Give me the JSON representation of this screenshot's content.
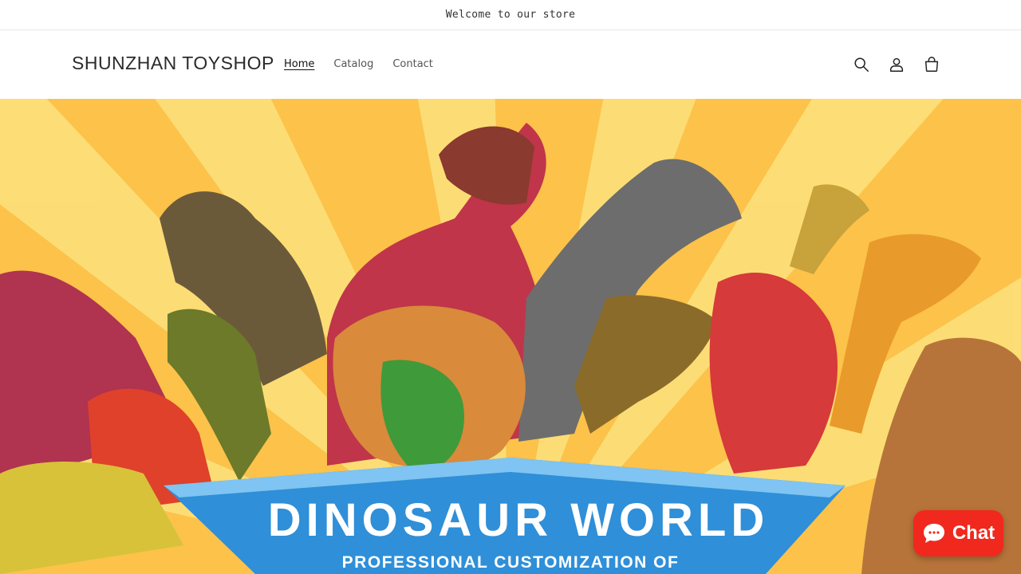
{
  "announcement": {
    "text": "Welcome to our store"
  },
  "header": {
    "logo": "SHUNZHAN TOYSHOP",
    "nav": [
      {
        "label": "Home",
        "active": true
      },
      {
        "label": "Catalog",
        "active": false
      },
      {
        "label": "Contact",
        "active": false
      }
    ],
    "icons": [
      "search-icon",
      "account-icon",
      "cart-icon"
    ]
  },
  "hero": {
    "banner_title": "DINOSAUR WORLD",
    "banner_subtitle": "PROFESSIONAL CUSTOMIZATION OF",
    "colors": {
      "sunburst_dark": "#fbb832",
      "sunburst_light": "#fde07a",
      "banner_blue": "#2f8fd8"
    }
  },
  "chat_widget": {
    "label": "Chat",
    "color": "#f1281e"
  }
}
